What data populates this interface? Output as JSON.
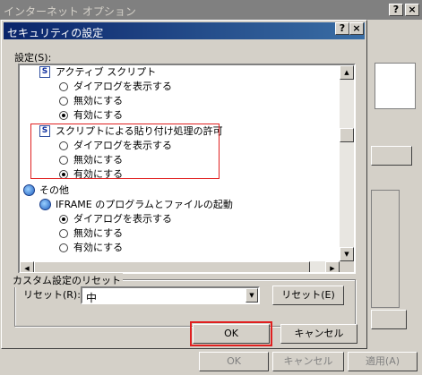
{
  "background_window": {
    "title": "インターネット オプション",
    "help_glyph": "?",
    "close_glyph": "×",
    "ok_label": "OK",
    "cancel_label": "キャンセル",
    "apply_label": "適用(A)"
  },
  "dialog": {
    "title": "セキュリティの設定",
    "help_glyph": "?",
    "close_glyph": "×",
    "settings_label": "設定(S):",
    "tree": [
      {
        "text": "アクティブ スクリプト",
        "kind": "node",
        "icon": "script-icon"
      },
      {
        "text": "ダイアログを表示する",
        "kind": "radio",
        "checked": false
      },
      {
        "text": "無効にする",
        "kind": "radio",
        "checked": false
      },
      {
        "text": "有効にする",
        "kind": "radio",
        "checked": true
      },
      {
        "text": "スクリプトによる貼り付け処理の許可",
        "kind": "node",
        "icon": "script-icon"
      },
      {
        "text": "ダイアログを表示する",
        "kind": "radio",
        "checked": false
      },
      {
        "text": "無効にする",
        "kind": "radio",
        "checked": false
      },
      {
        "text": "有効にする",
        "kind": "radio",
        "checked": true
      },
      {
        "text": "その他",
        "kind": "group",
        "icon": "globe-icon"
      },
      {
        "text": "IFRAME のプログラムとファイルの起動",
        "kind": "node",
        "icon": "globe-icon"
      },
      {
        "text": "ダイアログを表示する",
        "kind": "radio",
        "checked": true
      },
      {
        "text": "無効にする",
        "kind": "radio",
        "checked": false
      },
      {
        "text": "有効にする",
        "kind": "radio",
        "checked": false
      }
    ],
    "reset_group_label": "カスタム設定のリセット",
    "reset_label": "リセット(R):",
    "reset_value": "中",
    "reset_button": "リセット(E)",
    "ok_label": "OK",
    "cancel_label": "キャンセル"
  },
  "colors": {
    "highlight_border": "#e02020",
    "title_active": "#0a246a",
    "title_inactive": "#808080"
  }
}
